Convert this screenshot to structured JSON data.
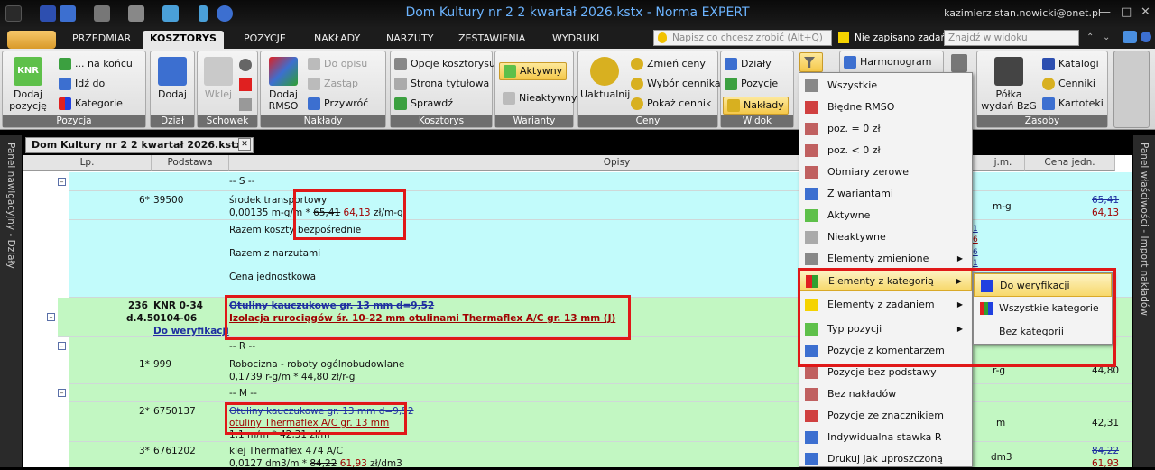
{
  "window": {
    "title": "Dom Kultury nr 2 2 kwartał 2026.kstx - Norma EXPERT",
    "user": "kazimierz.stan.nowicki@onet.pl"
  },
  "tabs": [
    "PRZEDMIAR",
    "KOSZTORYS",
    "POZYCJE",
    "NAKŁADY",
    "NARZUTY",
    "ZESTAWIENIA",
    "WYDRUKI"
  ],
  "search": {
    "hint": "Napisz co chcesz zrobić (Alt+Q)",
    "unsaved": "Nie zapisano zadań",
    "find": "Znajdź w widoku"
  },
  "ribbon": {
    "pozycja": {
      "label": "Pozycja",
      "add_line1": "Dodaj",
      "add_line2": "pozycję",
      "end": "... na końcu",
      "goto": "Idź do",
      "categories": "Kategorie"
    },
    "dzial": {
      "label": "Dział",
      "add": "Dodaj"
    },
    "schowek": {
      "label": "Schowek",
      "paste": "Wklej"
    },
    "naklady": {
      "label": "Nakłady",
      "add_line1": "Dodaj",
      "add_line2": "RMSO",
      "into": "Do opisu",
      "replace": "Zastąp",
      "recalc": "Przywróć"
    },
    "kosztorys": {
      "label": "Kosztorys",
      "options": "Opcje kosztorysu",
      "title_page": "Strona tytułowa",
      "check": "Sprawdź"
    },
    "warianty": {
      "label": "Warianty",
      "active": "Aktywny",
      "inactive": "Nieaktywny"
    },
    "ceny": {
      "label": "Ceny",
      "update": "Uaktualnij",
      "change": "Zmień ceny",
      "pick": "Wybór cennika",
      "show": "Pokaż cennik"
    },
    "widok": {
      "label": "Widok",
      "dzialy": "Działy",
      "pozycje": "Pozycje",
      "naklady": "Nakłady"
    },
    "harmonogram": "Harmonogram",
    "zasoby": {
      "label": "Zasoby",
      "shelf_line1": "Półka",
      "shelf_line2": "wydań BzG",
      "catalogs": "Katalogi",
      "pricelists": "Cenniki",
      "cards": "Kartoteki"
    }
  },
  "panels": {
    "left": "Panel nawigacyjny - Działy",
    "right": "Panel właściwości - Import nakładów"
  },
  "document_tab": "Dom Kultury nr 2 2 kwartał 2026.kstx*",
  "columns": {
    "lp": "Lp.",
    "podstawa": "Podstawa",
    "opisy": "Opisy",
    "jm": "j.m.",
    "cena": "Cena jedn."
  },
  "rows": {
    "s_header": "-- S --",
    "s1": {
      "lp": "6*",
      "podstawa": "39500",
      "line1": "środek transportowy",
      "line2_a": "0,00135 m-g/m *",
      "line2_old": "65,41",
      "line2_new": "64,13",
      "line2_unit": "zł/m-g",
      "jm": "m-g",
      "cena_old": "65,41",
      "cena_new": "64,13"
    },
    "sum1": "Razem koszty bezpośrednie",
    "sum2": "Razem z narzutami",
    "sum3": "Cena jednostkowa",
    "sum_vals": [
      "1",
      "6",
      "6",
      "1"
    ],
    "pos": {
      "lp_line1": "236",
      "lp_line2": "d.4.5",
      "pod_line1": "KNR 0-34",
      "pod_line2": "0104-06",
      "category": "Do weryfikacji",
      "old_desc": "Otuliny kauczukowe gr. 13 mm d=9,52",
      "new_desc": "Izolacja rurociągów śr. 10-22 mm otulinami Thermaflex A/C gr. 13 mm (J)"
    },
    "r_header": "-- R --",
    "r1": {
      "lp": "1*",
      "podstawa": "999",
      "line1": "Robocizna - roboty ogólnobudowlane",
      "line2": "0,1739 r-g/m * 44,80 zł/r-g",
      "jm": "r-g",
      "cena": "44,80"
    },
    "m_header": "-- M --",
    "m1": {
      "lp": "2*",
      "podstawa": "6750137",
      "old": "Otuliny kauczukowe gr. 13 mm d=9,52",
      "new": "otuliny Thermaflex A/C gr. 13 mm",
      "line3": "1,1 m/m * 42,31 zł/m",
      "jm": "m",
      "cena": "42,31"
    },
    "m2": {
      "lp": "3*",
      "podstawa": "6761202",
      "line1": "klej Thermaflex 474 A/C",
      "line2_a": "0,0127 dm3/m *",
      "line2_old": "84,22",
      "line2_new": "61,93",
      "line2_unit": "zł/dm3",
      "jm": "dm3",
      "cena_old": "84,22",
      "cena_new": "61,93"
    }
  },
  "filter_menu": [
    "Wszystkie",
    "Błędne RMSO",
    "poz. = 0 zł",
    "poz. < 0 zł",
    "Obmiary zerowe",
    "Z wariantami",
    "Aktywne",
    "Nieaktywne",
    "Elementy zmienione",
    "Elementy z kategorią",
    "Elementy z zadaniem",
    "Typ pozycji",
    "Pozycje z komentarzem",
    "Pozycje bez podstawy",
    "Bez nakładów",
    "Pozycje ze znacznikiem",
    "Indywidualna stawka R",
    "Drukuj jak uproszczoną"
  ],
  "submenu": [
    "Do weryfikacji",
    "Wszystkie kategorie",
    "Bez kategorii"
  ],
  "colors": {
    "cyan_row": "#c2fbfb",
    "green_row": "#c2f7c2",
    "highlight": "#e01818",
    "title": "#6cb4ff"
  }
}
